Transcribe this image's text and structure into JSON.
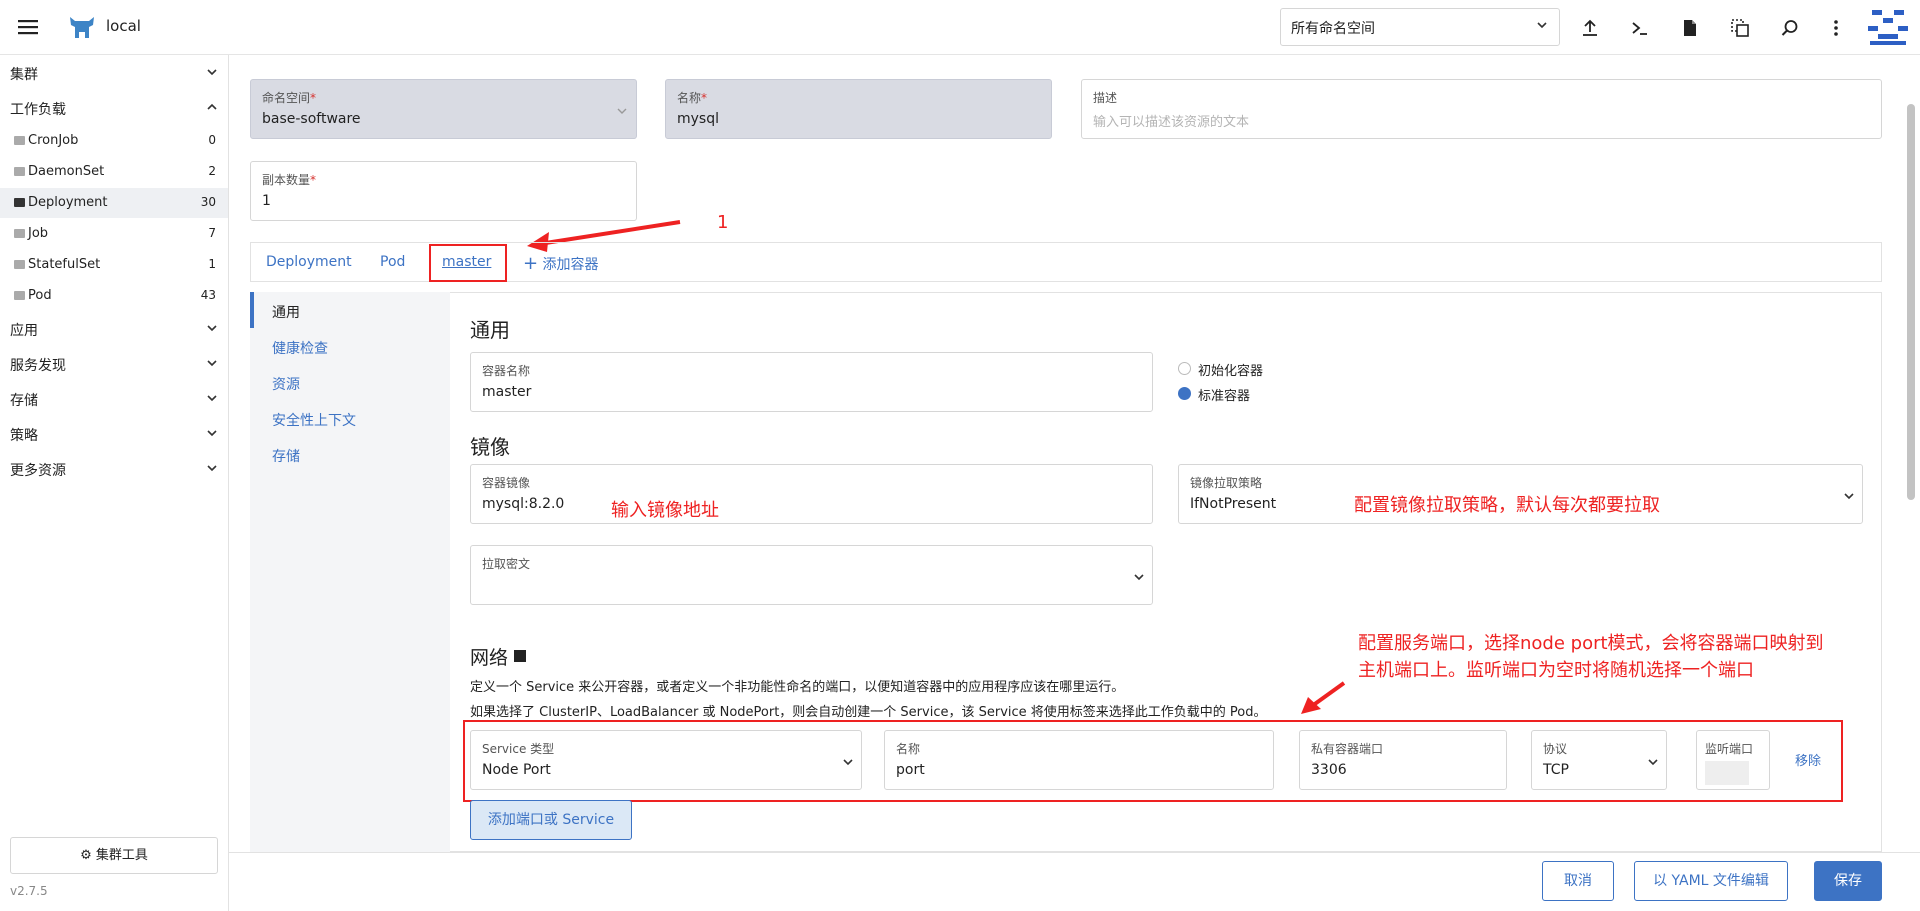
{
  "header": {
    "cluster_name": "local",
    "namespace_select": "所有命名空间"
  },
  "sidebar": {
    "groups": [
      "集群",
      "工作负载",
      "应用",
      "服务发现",
      "存储",
      "策略",
      "更多资源"
    ],
    "workloads": [
      {
        "label": "CronJob",
        "count": "0"
      },
      {
        "label": "DaemonSet",
        "count": "2"
      },
      {
        "label": "Deployment",
        "count": "30"
      },
      {
        "label": "Job",
        "count": "7"
      },
      {
        "label": "StatefulSet",
        "count": "1"
      },
      {
        "label": "Pod",
        "count": "43"
      }
    ],
    "cluster_tools": "集群工具",
    "version": "v2.7.5"
  },
  "form": {
    "namespace": {
      "label": "命名空间",
      "value": "base-software"
    },
    "name": {
      "label": "名称",
      "value": "mysql"
    },
    "description": {
      "label": "描述",
      "placeholder": "输入可以描述该资源的文本"
    },
    "replicas": {
      "label": "副本数量",
      "value": "1"
    }
  },
  "tabs": [
    "Deployment",
    "Pod",
    "master",
    "添加容器"
  ],
  "subnav": [
    "通用",
    "健康检查",
    "资源",
    "安全性上下文",
    "存储"
  ],
  "general": {
    "title": "通用",
    "container_name": {
      "label": "容器名称",
      "value": "master"
    },
    "radio_init": "初始化容器",
    "radio_standard": "标准容器"
  },
  "image": {
    "title": "镜像",
    "container_image": {
      "label": "容器镜像",
      "value": "mysql:8.2.0"
    },
    "pull_policy": {
      "label": "镜像拉取策略",
      "value": "IfNotPresent"
    },
    "pull_secret": {
      "label": "拉取密文"
    }
  },
  "network": {
    "title": "网络",
    "desc1": "定义一个 Service 来公开容器，或者定义一个非功能性命名的端口，以便知道容器中的应用程序应该在哪里运行。",
    "desc2": "如果选择了 ClusterIP、LoadBalancer 或 NodePort，则会自动创建一个 Service，该 Service 将使用标签来选择此工作负载中的 Pod。",
    "service_type": {
      "label": "Service 类型",
      "value": "Node Port"
    },
    "port_name": {
      "label": "名称",
      "value": "port"
    },
    "private_port": {
      "label": "私有容器端口",
      "value": "3306"
    },
    "protocol": {
      "label": "协议",
      "value": "TCP"
    },
    "listen_port": {
      "label": "监听端口"
    },
    "remove": "移除",
    "add_port": "添加端口或 Service"
  },
  "annotations": {
    "step1": "1",
    "image_hint": "输入镜像地址",
    "pull_hint": "配置镜像拉取策略，默认每次都要拉取",
    "port_hint_1": "配置服务端口，选择node port模式，会将容器端口映射到",
    "port_hint_2": "主机端口上。监听端口为空时将随机选择一个端口"
  },
  "footer": {
    "cancel": "取消",
    "yaml": "以 YAML 文件编辑",
    "save": "保存"
  },
  "colors": {
    "accent": "#3d73c4",
    "annotation": "#e22222"
  }
}
